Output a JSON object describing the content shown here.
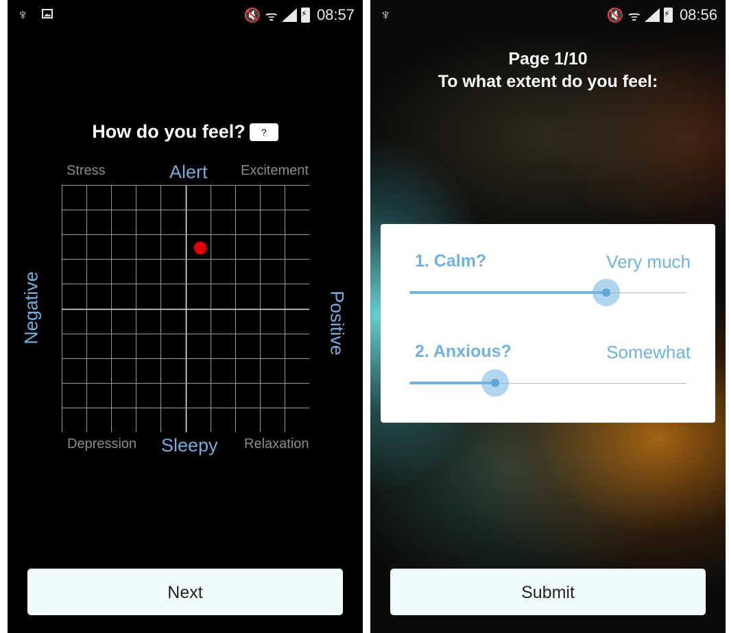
{
  "left_screen": {
    "status": {
      "time": "08:57"
    },
    "title": "How do you feel?",
    "help_label": "?",
    "corners": {
      "top_left": "Stress",
      "top_right": "Excitement",
      "bottom_left": "Depression",
      "bottom_right": "Relaxation"
    },
    "axes": {
      "top": "Alert",
      "bottom": "Sleepy",
      "left": "Negative",
      "right": "Positive"
    },
    "grid": {
      "columns": 10,
      "rows": 10,
      "marker": {
        "col": 5.6,
        "row": 2.55
      },
      "marker_color": "#e00000"
    },
    "next_label": "Next"
  },
  "right_screen": {
    "status": {
      "time": "08:56"
    },
    "page": "Page 1/10",
    "prompt": "To what extent do you feel:",
    "questions": [
      {
        "label": "1. Calm?",
        "answer": "Very much",
        "value": 0.71
      },
      {
        "label": "2. Anxious?",
        "answer": "Somewhat",
        "value": 0.31
      }
    ],
    "submit_label": "Submit"
  },
  "colors": {
    "accent": "#6fb2e0",
    "button_bg": "#f0fbfd",
    "marker": "#e00000"
  }
}
